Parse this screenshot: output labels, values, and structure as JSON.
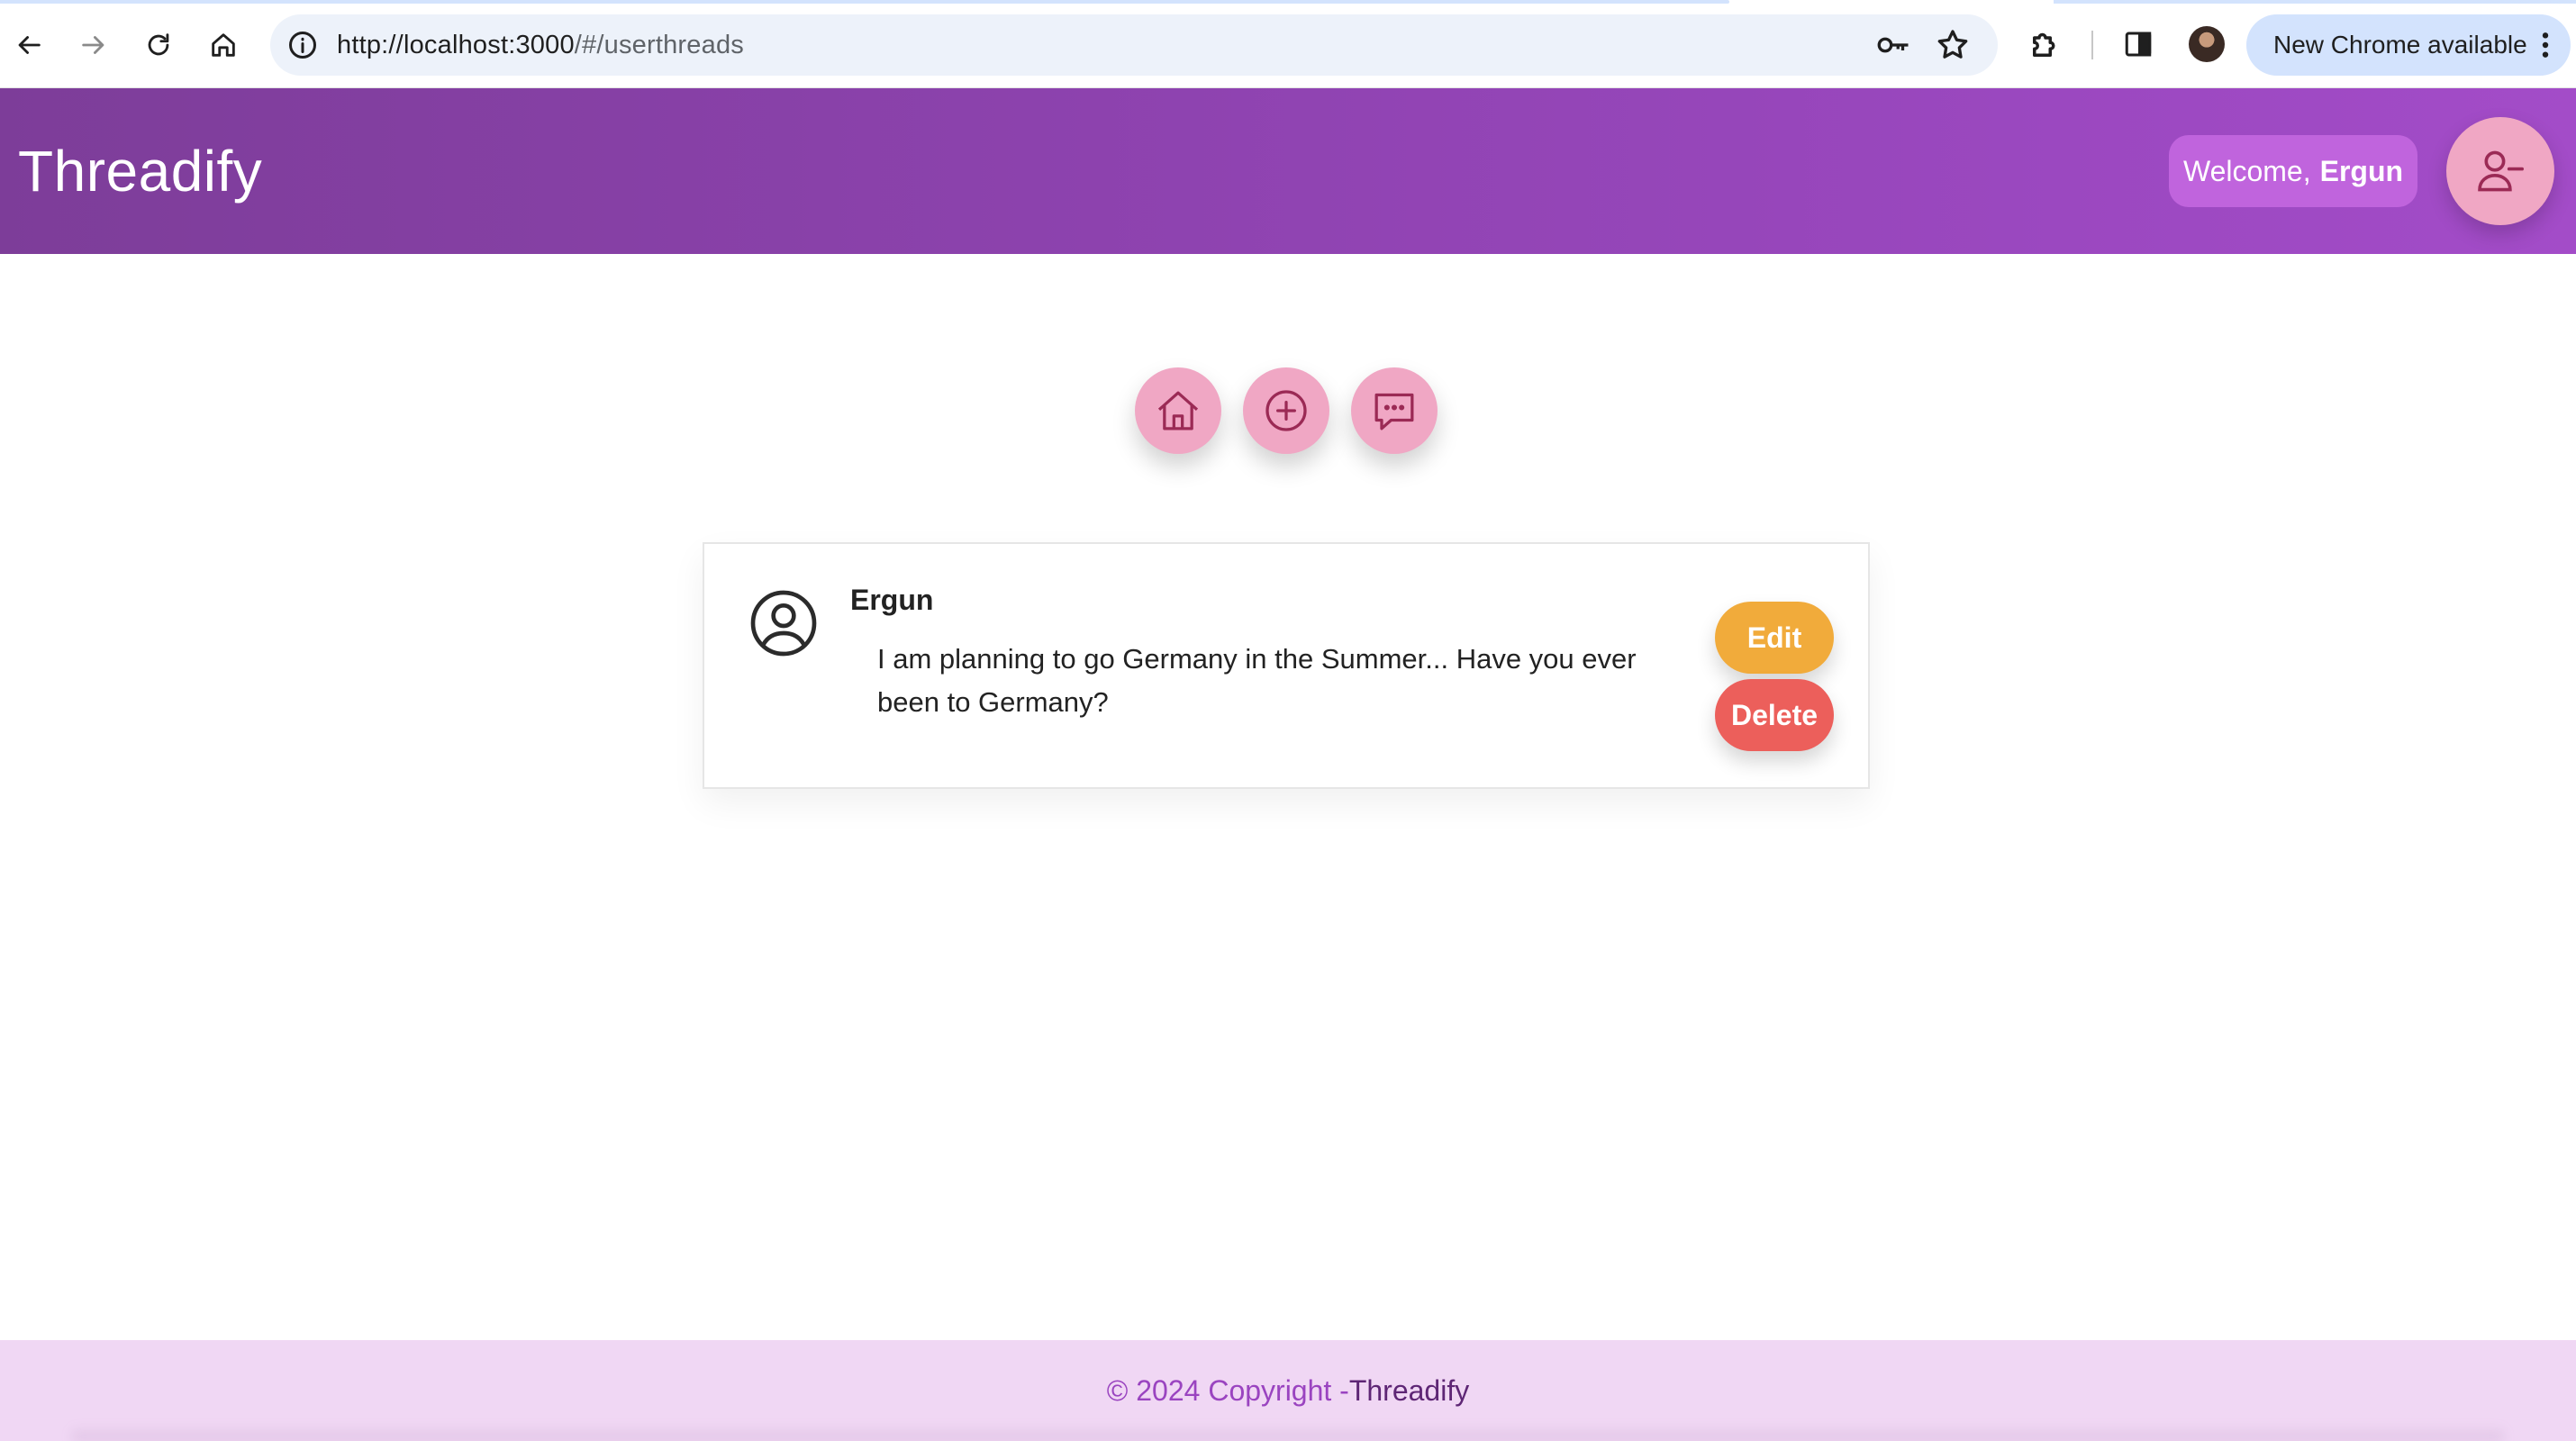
{
  "browser": {
    "url_host": "http://localhost:3000",
    "url_path": "/#/userthreads",
    "update_label": "New Chrome available"
  },
  "header": {
    "brand": "Threadify",
    "welcome_prefix": "Welcome,",
    "welcome_name": "Ergun"
  },
  "nav": {
    "items": [
      {
        "name": "home",
        "icon": "house-icon"
      },
      {
        "name": "create-thread",
        "icon": "plus-circle-icon"
      },
      {
        "name": "threads",
        "icon": "chat-bubble-icon"
      }
    ]
  },
  "threads": [
    {
      "author": "Ergun",
      "content": "I am planning to go Germany in the Summer... Have you ever been to Germany?",
      "edit_label": "Edit",
      "delete_label": "Delete"
    }
  ],
  "footer": {
    "copyright": "© 2024 Copyright -",
    "brand": "Threadify"
  },
  "colors": {
    "header_start": "#7d3d99",
    "header_end": "#a34cc8",
    "pink_button": "#f0a7c4",
    "icon_stroke": "#9b2a55",
    "edit": "#f1ab3b",
    "delete": "#ec5f5b",
    "footer_bg": "#f0d7f4"
  }
}
